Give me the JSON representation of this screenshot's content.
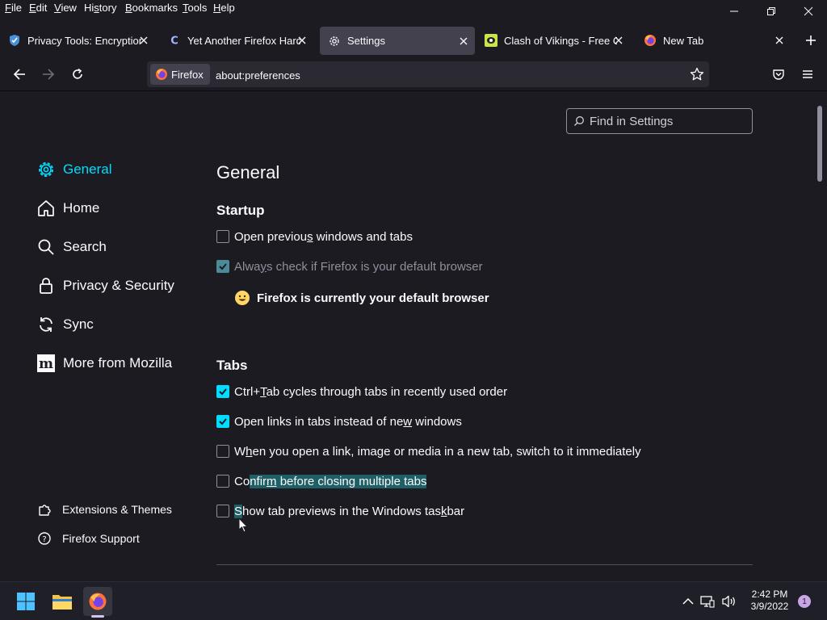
{
  "menu": {
    "file": {
      "u": "F",
      "rest": "ile"
    },
    "edit": {
      "u": "E",
      "rest": "dit"
    },
    "view": {
      "u": "V",
      "rest": "iew"
    },
    "history": {
      "pre": "Hi",
      "u": "s",
      "rest": "tory"
    },
    "bookmarks": {
      "u": "B",
      "rest": "ookmarks"
    },
    "tools": {
      "u": "T",
      "rest": "ools"
    },
    "help": {
      "u": "H",
      "rest": "elp"
    }
  },
  "tabs": [
    {
      "label": "Privacy Tools: Encryption A",
      "icon": "shield-icon"
    },
    {
      "label": "Yet Another Firefox Harden",
      "icon": "c-site-icon"
    },
    {
      "label": "Settings",
      "icon": "gear-icon"
    },
    {
      "label": "Clash of Vikings - Free Onl",
      "icon": "eye-site-icon"
    },
    {
      "label": "New Tab",
      "icon": "firefox-icon"
    }
  ],
  "navbar": {
    "identity_label": "Firefox",
    "url": "about:preferences"
  },
  "search": {
    "placeholder": "Find in Settings"
  },
  "sidebar": {
    "items": [
      {
        "label": "General",
        "icon": "gear-icon",
        "selected": true
      },
      {
        "label": "Home",
        "icon": "home-icon"
      },
      {
        "label": "Search",
        "icon": "search-icon"
      },
      {
        "label": "Privacy & Security",
        "icon": "lock-icon"
      },
      {
        "label": "Sync",
        "icon": "sync-icon"
      },
      {
        "label": "More from Mozilla",
        "icon": "mozilla-m-icon"
      }
    ],
    "footer": [
      {
        "label": "Extensions & Themes",
        "icon": "puzzle-icon"
      },
      {
        "label": "Firefox Support",
        "icon": "help-icon"
      }
    ]
  },
  "main": {
    "title": "General",
    "startup": {
      "heading": "Startup",
      "open_previous": {
        "pre": "Open previou",
        "u": "s",
        "post": " windows and tabs",
        "checked": false
      },
      "always_check": {
        "pre": "Alwa",
        "u": "y",
        "post": "s check if Firefox is your default browser",
        "checked": true,
        "disabled": true
      },
      "default_status": "Firefox is currently your default browser"
    },
    "tabs": {
      "heading": "Tabs",
      "ctrl_tab": {
        "pre": "Ctrl+",
        "u": "T",
        "post": "ab cycles through tabs in recently used order",
        "checked": true
      },
      "open_links": {
        "pre": "Open links in tabs instead of ne",
        "u": "w",
        "post": " windows",
        "checked": true
      },
      "switch_to": {
        "pre": "W",
        "u": "h",
        "post": "en you open a link, image or media in a new tab, switch to it immediately",
        "checked": false
      },
      "confirm_close": {
        "pre": "Co",
        "hl1": "nfir",
        "u": "m",
        "hl2": " before closing multiple tabs",
        "checked": false
      },
      "previews": {
        "hl": "S",
        "pre": "how tab previews in the Windows tas",
        "u": "k",
        "post": "bar",
        "checked": false
      }
    }
  },
  "taskbar": {
    "time": "2:42 PM",
    "date": "3/9/2022",
    "notifications": "1"
  },
  "colors": {
    "accent": "#00ddff",
    "background": "#1c1b22",
    "text": "#fbfbfe"
  }
}
